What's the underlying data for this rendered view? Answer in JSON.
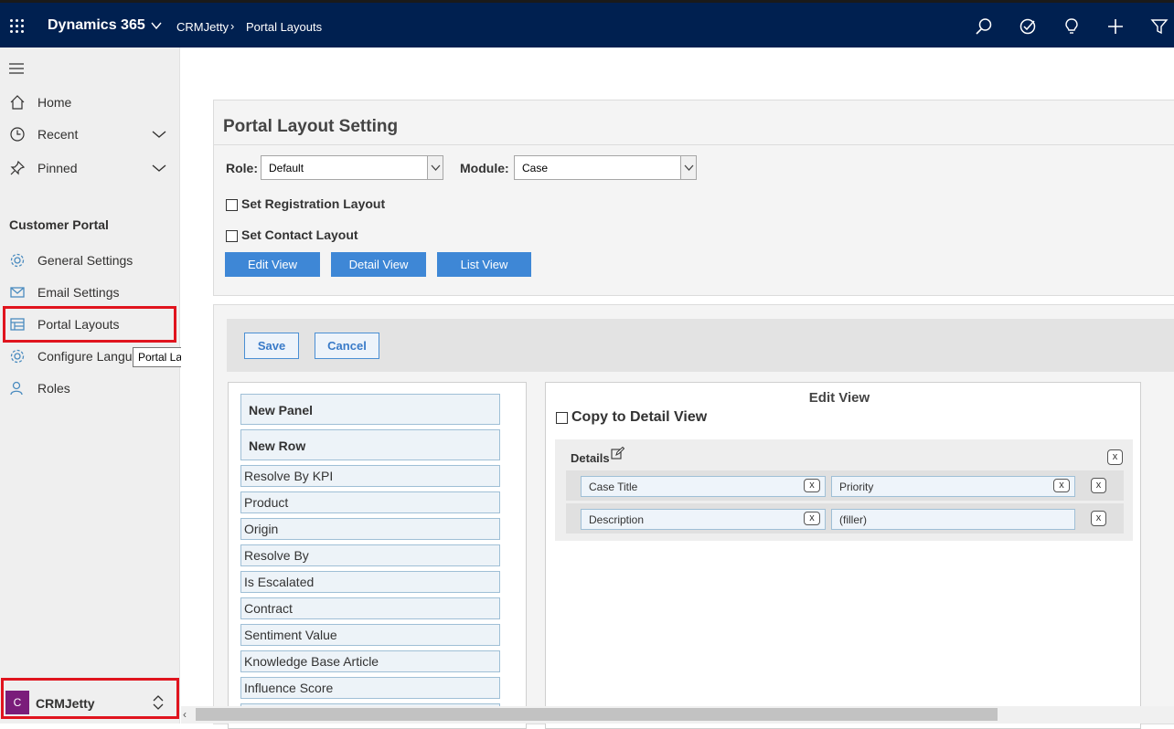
{
  "topbar": {
    "app_name": "Dynamics 365",
    "breadcrumb": [
      "CRMJetty",
      "Portal Layouts"
    ],
    "icons": [
      "search-icon",
      "task-icon",
      "lightbulb-icon",
      "plus-icon",
      "filter-icon"
    ]
  },
  "sidebar": {
    "nav": [
      {
        "label": "Home",
        "icon": "home-icon"
      },
      {
        "label": "Recent",
        "icon": "clock-icon"
      },
      {
        "label": "Pinned",
        "icon": "pin-icon"
      }
    ],
    "section_title": "Customer Portal",
    "items": [
      {
        "label": "General Settings",
        "icon": "gear-icon"
      },
      {
        "label": "Email Settings",
        "icon": "email-settings-icon"
      },
      {
        "label": "Portal Layouts",
        "icon": "layout-icon"
      },
      {
        "label": "Configure Langua",
        "icon": "language-gear-icon"
      },
      {
        "label": "Roles",
        "icon": "roles-icon"
      }
    ],
    "tooltip": "Portal Layouts",
    "area": {
      "badge": "C",
      "name": "CRMJetty"
    }
  },
  "layout_setting": {
    "title": "Portal Layout Setting",
    "role_label": "Role:",
    "role_value": "Default",
    "module_label": "Module:",
    "module_value": "Case",
    "registration_label": "Set Registration Layout",
    "contact_label": "Set Contact Layout",
    "buttons": [
      "Edit View",
      "Detail View",
      "List View"
    ]
  },
  "editor": {
    "save_label": "Save",
    "cancel_label": "Cancel",
    "new_panel": "New Panel",
    "new_row": "New Row",
    "fields": [
      "Resolve By KPI",
      "Product",
      "Origin",
      "Resolve By",
      "Is Escalated",
      "Contract",
      "Sentiment Value",
      "Knowledge Base Article",
      "Influence Score"
    ],
    "view_title": "Edit View",
    "copy_label": "Copy to Detail View",
    "details_label": "Details",
    "remove_glyph": "x",
    "rows": [
      [
        "Case Title",
        "Priority"
      ],
      [
        "Description",
        "(filler)"
      ]
    ]
  }
}
